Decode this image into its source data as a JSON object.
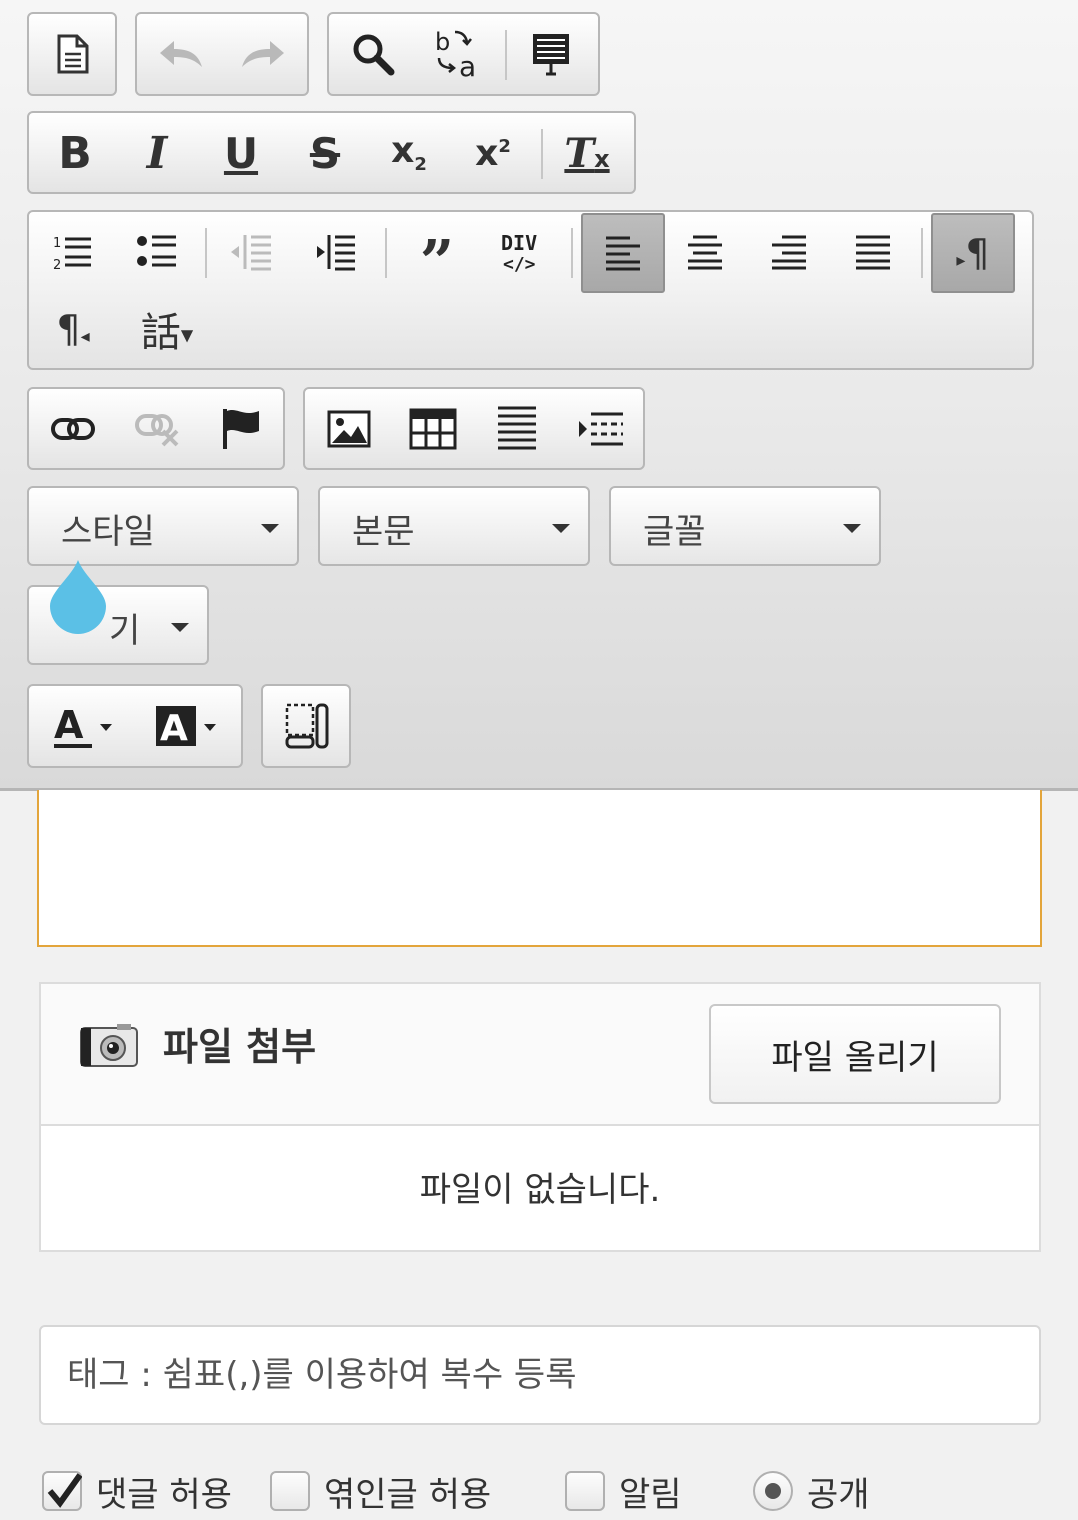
{
  "toolbar": {
    "format_combos": {
      "style": "스타일",
      "format": "본문",
      "font": "글꼴",
      "size": "크기"
    },
    "size_visible": "기"
  },
  "attachments": {
    "title": "파일 첨부",
    "upload_label": "파일 올리기",
    "empty_message": "파일이 없습니다."
  },
  "tags": {
    "placeholder": "태그 : 쉼표(,)를 이용하여 복수 등록"
  },
  "options": {
    "allow_comments": {
      "label": "댓글 허용",
      "checked": true
    },
    "allow_trackback": {
      "label": "엮인글 허용",
      "checked": false
    },
    "notify": {
      "label": "알림",
      "checked": false
    },
    "public": {
      "label": "공개",
      "selected": true
    }
  },
  "colors": {
    "editor_focus_border": "#e3a53b",
    "drop_handle": "#5bc0e6"
  }
}
